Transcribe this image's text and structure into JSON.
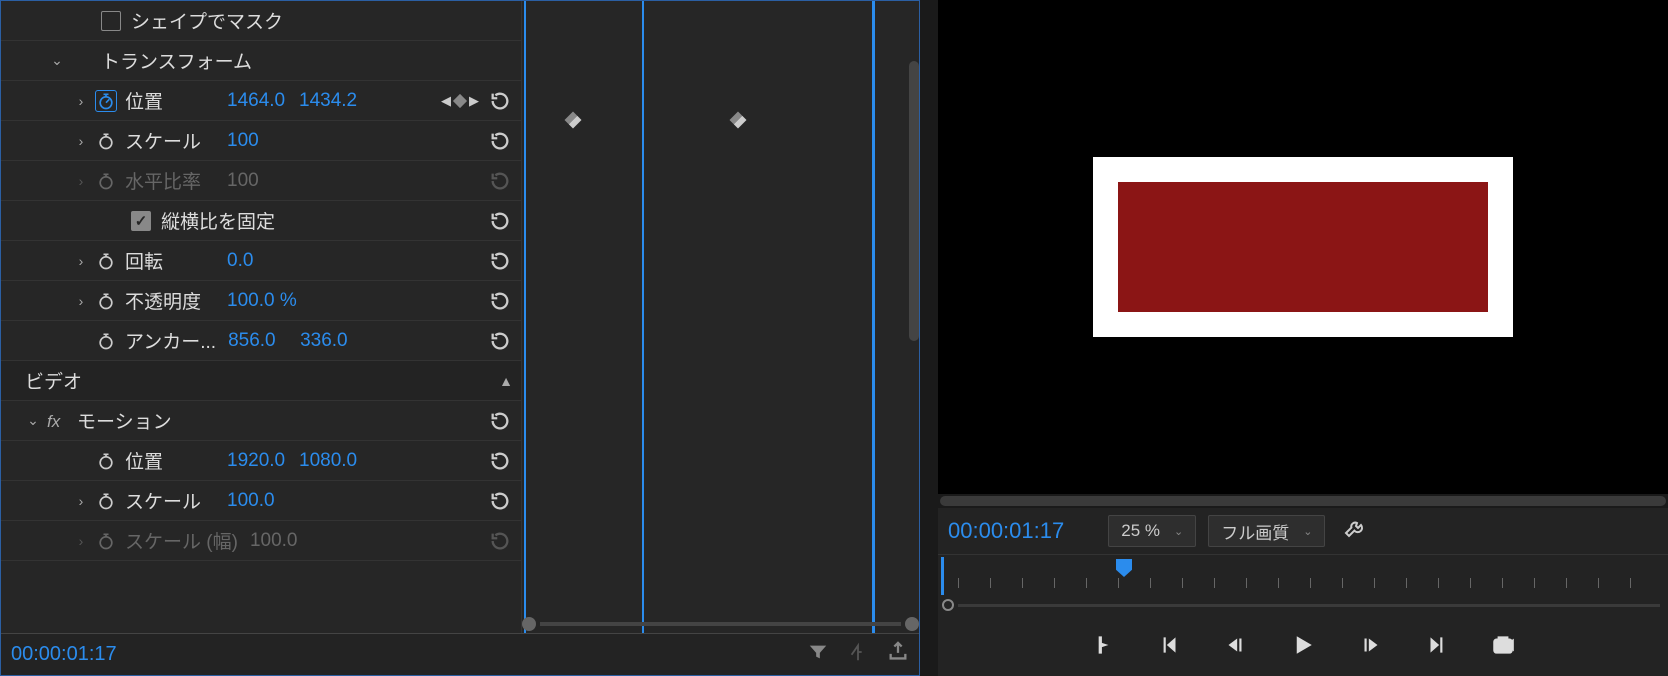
{
  "effects": {
    "mask_shape_label": "シェイプでマスク",
    "transform_label": "トランスフォーム",
    "position": {
      "label": "位置",
      "x": "1464.0",
      "y": "1434.2"
    },
    "scale": {
      "label": "スケール",
      "value": "100"
    },
    "h_ratio": {
      "label": "水平比率",
      "value": "100"
    },
    "lock_aspect_label": "縦横比を固定",
    "rotation": {
      "label": "回転",
      "value": "0.0"
    },
    "opacity": {
      "label": "不透明度",
      "value": "100.0 %"
    },
    "anchor": {
      "label": "アンカー...",
      "x": "856.0",
      "y": "336.0"
    }
  },
  "video_section": "ビデオ",
  "motion": {
    "label": "モーション",
    "position": {
      "label": "位置",
      "x": "1920.0",
      "y": "1080.0"
    },
    "scale": {
      "label": "スケール",
      "value": "100.0"
    },
    "scale_w": {
      "label": "スケール (幅)",
      "value": "100.0"
    }
  },
  "timecode": "00:00:01:17",
  "monitor": {
    "timecode": "00:00:01:17",
    "zoom": "25 %",
    "quality": "フル画質"
  },
  "preview": {
    "outer_color": "#ffffff",
    "inner_color": "#8b1515"
  }
}
